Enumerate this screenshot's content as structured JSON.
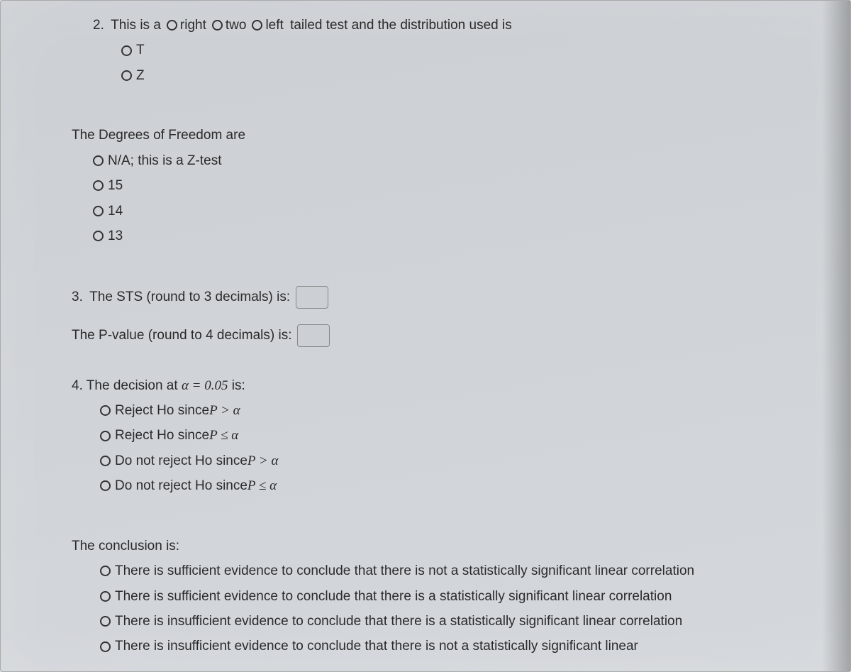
{
  "q2": {
    "num": "2.",
    "prefix": "This is a",
    "opt1": "right",
    "opt2": "two",
    "opt3": "left",
    "after": "tailed test and the distribution used is",
    "distOpts": [
      "T",
      "Z"
    ]
  },
  "df": {
    "heading": "The Degrees of Freedom are",
    "opts": [
      "N/A; this is a Z-test",
      "15",
      "14",
      "13"
    ]
  },
  "q3": {
    "num": "3.",
    "sts": "The STS (round to 3 decimals) is:",
    "pval": "The P-value (round to 4 decimals) is:"
  },
  "q4": {
    "num": "4.",
    "prompt_a": "The decision at ",
    "prompt_b": "α = 0.05",
    "prompt_c": " is:",
    "opts": [
      {
        "a": "Reject Ho since ",
        "b": "P > α"
      },
      {
        "a": "Reject Ho since ",
        "b": "P ≤ α"
      },
      {
        "a": "Do not reject Ho since ",
        "b": "P > α"
      },
      {
        "a": "Do not reject Ho since ",
        "b": "P ≤ α"
      }
    ]
  },
  "concl": {
    "heading": "The conclusion is:",
    "opts": [
      "There is sufficient evidence to conclude that there is not a statistically significant linear correlation",
      "There is sufficient evidence to conclude that there is a statistically significant linear correlation",
      "There is insufficient evidence to conclude that there is a statistically significant linear correlation",
      "There is insufficient evidence to conclude that there is not a statistically significant linear"
    ]
  }
}
